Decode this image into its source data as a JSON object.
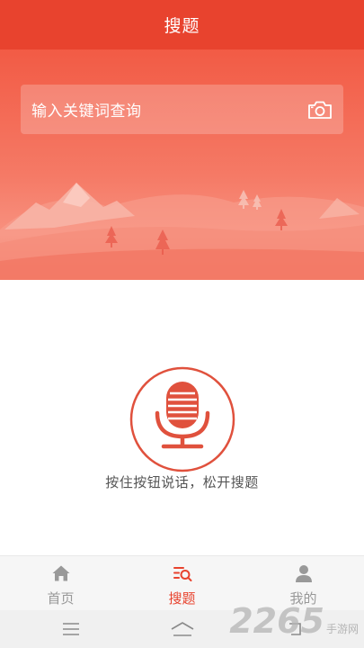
{
  "header": {
    "title": "搜题"
  },
  "search": {
    "placeholder": "输入关键词查询",
    "camera_icon": "camera-icon"
  },
  "voice": {
    "hint": "按住按钮说话，松开搜题",
    "mic_icon": "microphone-icon"
  },
  "tabbar": {
    "items": [
      {
        "label": "首页",
        "icon": "home-icon",
        "active": false
      },
      {
        "label": "搜题",
        "icon": "search-list-icon",
        "active": true
      },
      {
        "label": "我的",
        "icon": "user-icon",
        "active": false
      }
    ]
  },
  "system_nav": {
    "icons": [
      "menu-icon",
      "home-outline-icon",
      "back-icon"
    ]
  },
  "watermark": {
    "big": "2265",
    "small": "手游网"
  },
  "colors": {
    "accent": "#e8432e",
    "hero_light": "#f8917f",
    "inactive": "#999999"
  }
}
